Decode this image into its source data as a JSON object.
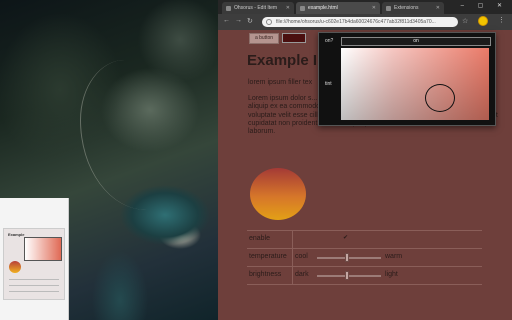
{
  "browser": {
    "tabs": [
      {
        "label": "Ohsorus - Edit Item"
      },
      {
        "label": "example.html"
      },
      {
        "label": "Extensions"
      }
    ],
    "window_controls": "– ▢ ✕",
    "url": "file:///home/ohsorus/u-c602e17b4da60024676c477ab32f811d3405a70..."
  },
  "page": {
    "button_label": "a button",
    "swatch_color": "#4a0f0f",
    "title": "Example I",
    "filler": "lorem ipsum filler tex",
    "paragraph": "Lorem ipsum dolor s... eiusmod tempor incid... enim ad minim venia... nisi ut aliquip ex ea commodo consequat. Duis aute irure dolor in reprehenderit in voluptate velit esse cillum dolore eu fugiat nulla pariatur. Excepteur sint occaecat cupidatat non proident, sunt in culpa qui officia deserunt mollit anim id est laborum.",
    "settings": {
      "enable": {
        "label": "enable",
        "checked": true,
        "check_glyph": "✔"
      },
      "temperature": {
        "label": "temperature",
        "low": "cool",
        "high": "warm",
        "value": 0.45
      },
      "brightness": {
        "label": "brightness",
        "low": "dark",
        "high": "light",
        "value": 0.45
      }
    }
  },
  "popup": {
    "on_label": "on?",
    "on_button": "on",
    "tint_label": "tint"
  },
  "thumbnail": {
    "title": "Example"
  }
}
